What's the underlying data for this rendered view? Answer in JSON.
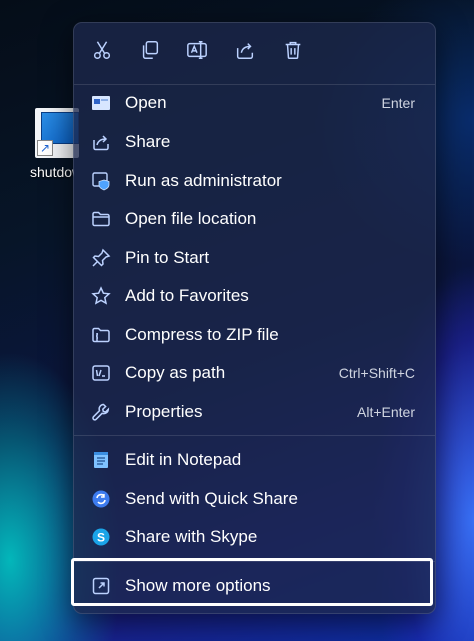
{
  "desktop": {
    "icon_label": "shutdown"
  },
  "quick_actions": [
    {
      "icon": "cut-icon"
    },
    {
      "icon": "copy-icon"
    },
    {
      "icon": "rename-icon"
    },
    {
      "icon": "share-icon"
    },
    {
      "icon": "delete-icon"
    }
  ],
  "menu": {
    "items": [
      {
        "label": "Open",
        "shortcut": "Enter",
        "icon": "open-icon"
      },
      {
        "label": "Share",
        "shortcut": "",
        "icon": "share-icon"
      },
      {
        "label": "Run as administrator",
        "shortcut": "",
        "icon": "shield-icon"
      },
      {
        "label": "Open file location",
        "shortcut": "",
        "icon": "folder-icon"
      },
      {
        "label": "Pin to Start",
        "shortcut": "",
        "icon": "pin-icon"
      },
      {
        "label": "Add to Favorites",
        "shortcut": "",
        "icon": "star-icon"
      },
      {
        "label": "Compress to ZIP file",
        "shortcut": "",
        "icon": "zip-icon"
      },
      {
        "label": "Copy as path",
        "shortcut": "Ctrl+Shift+C",
        "icon": "path-icon"
      },
      {
        "label": "Properties",
        "shortcut": "Alt+Enter",
        "icon": "wrench-icon"
      },
      {
        "label": "Edit in Notepad",
        "shortcut": "",
        "icon": "notepad-icon"
      },
      {
        "label": "Send with Quick Share",
        "shortcut": "",
        "icon": "quick-share-icon"
      },
      {
        "label": "Share with Skype",
        "shortcut": "",
        "icon": "skype-icon"
      },
      {
        "label": "Show more options",
        "shortcut": "",
        "icon": "more-options-icon"
      }
    ]
  },
  "colors": {
    "menu_bg": "#1c284b",
    "text": "#ffffff",
    "shortcut_text": "#cfd4e0",
    "highlight": "#ffffff"
  }
}
